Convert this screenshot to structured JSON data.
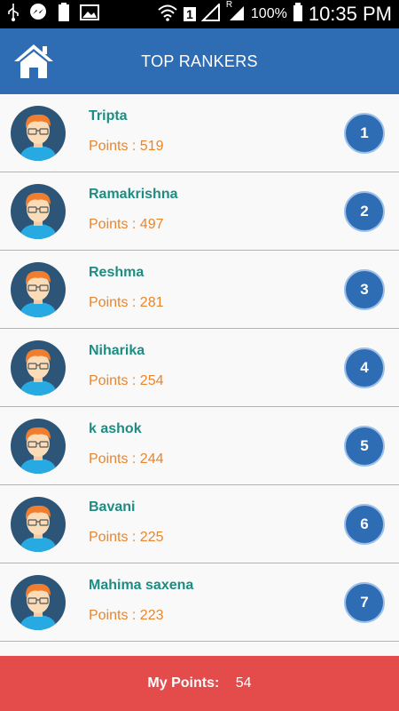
{
  "status_bar": {
    "battery_pct": "100%",
    "time": "10:35 PM",
    "sim_slot": "1",
    "roaming": "R",
    "battery_small": "100"
  },
  "header": {
    "title": "TOP RANKERS",
    "home_icon": "home-icon",
    "bg_color": "#2e6db4"
  },
  "rankers": [
    {
      "name": "Tripta",
      "points": "Points : 519",
      "rank": "1"
    },
    {
      "name": "Ramakrishna",
      "points": "Points : 497",
      "rank": "2"
    },
    {
      "name": "Reshma",
      "points": "Points : 281",
      "rank": "3"
    },
    {
      "name": "Niharika",
      "points": "Points : 254",
      "rank": "4"
    },
    {
      "name": "k ashok",
      "points": "Points : 244",
      "rank": "5"
    },
    {
      "name": "Bavani",
      "points": "Points : 225",
      "rank": "6"
    },
    {
      "name": "Mahima saxena",
      "points": "Points : 223",
      "rank": "7"
    }
  ],
  "footer": {
    "label": "My Points:",
    "value": "54",
    "bg_color": "#e44b4b"
  },
  "colors": {
    "name": "#1e8c82",
    "points": "#e8862e",
    "badge": "#2e6db4"
  }
}
